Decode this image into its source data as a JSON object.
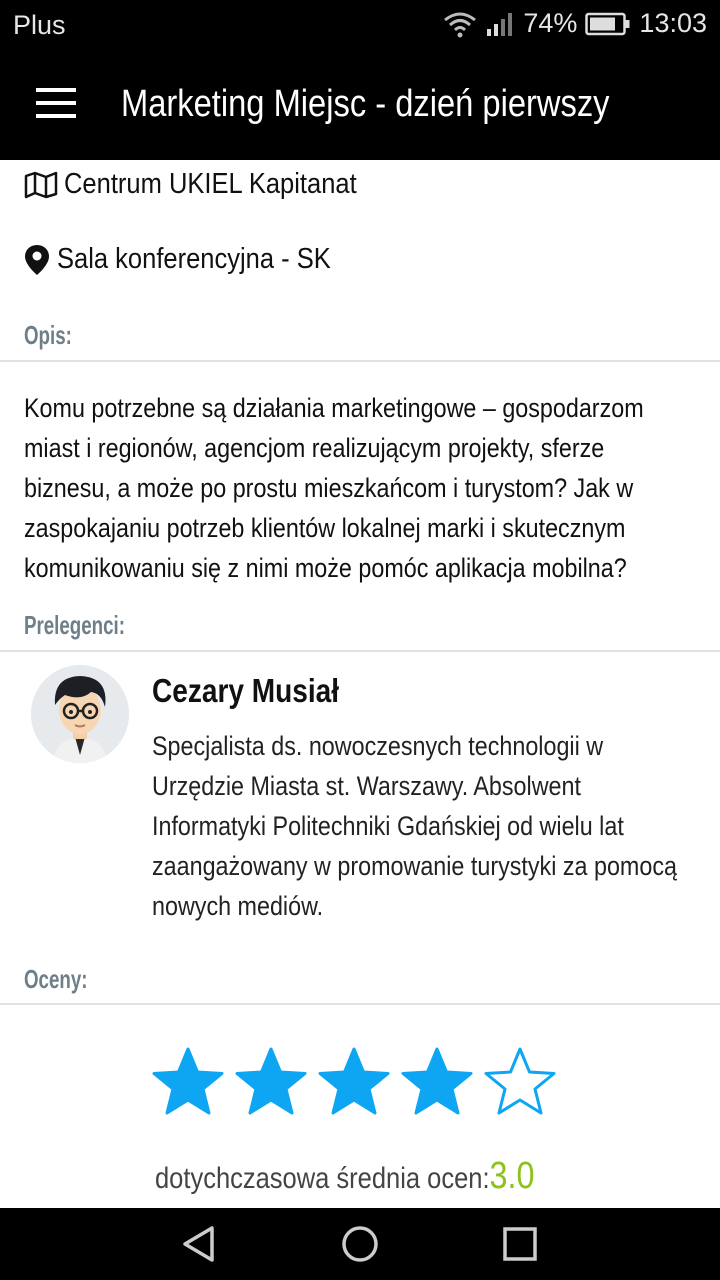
{
  "status_bar": {
    "carrier": "Plus",
    "battery": "74%",
    "time": "13:03"
  },
  "app_bar": {
    "title": "Marketing Miejsc - dzień pierwszy"
  },
  "location": {
    "venue": "Centrum UKIEL Kapitanat",
    "room": "Sala konferencyjna - SK"
  },
  "description": {
    "header": "Opis:",
    "text": "Komu potrzebne są działania marketingowe – gospodarzom miast i regionów, agencjom realizującym projekty, sferze biznesu, a może po prostu mieszkańcom i turystom? Jak w zaspokajaniu potrzeb klientów lokalnej marki i skutecznym komunikowaniu się z nimi może pomóc aplikacja mobilna?"
  },
  "speakers": {
    "header": "Prelegenci:",
    "items": [
      {
        "name": "Cezary Musiał",
        "bio": "Specjalista ds. nowoczesnych technologii w Urzędzie Miasta st. Warszawy. Absolwent Informatyki Politechniki Gdańskiej od wielu lat zaangażowany w promowanie turystyki za pomocą nowych mediów."
      }
    ]
  },
  "ratings": {
    "header": "Oceny:",
    "stars_filled": 4,
    "stars_total": 5,
    "average_label": "dotychczasowa średnia ocen:",
    "average_value": "3.0"
  },
  "colors": {
    "accent_star": "#0ea5f2",
    "average_value": "#8cc21a",
    "section_header": "#6f7f8a"
  },
  "icons": [
    "wifi-icon",
    "signal-icon",
    "battery-icon",
    "menu-icon",
    "map-icon",
    "location-pin-icon",
    "star-icon",
    "back-icon",
    "home-icon",
    "recents-icon"
  ]
}
